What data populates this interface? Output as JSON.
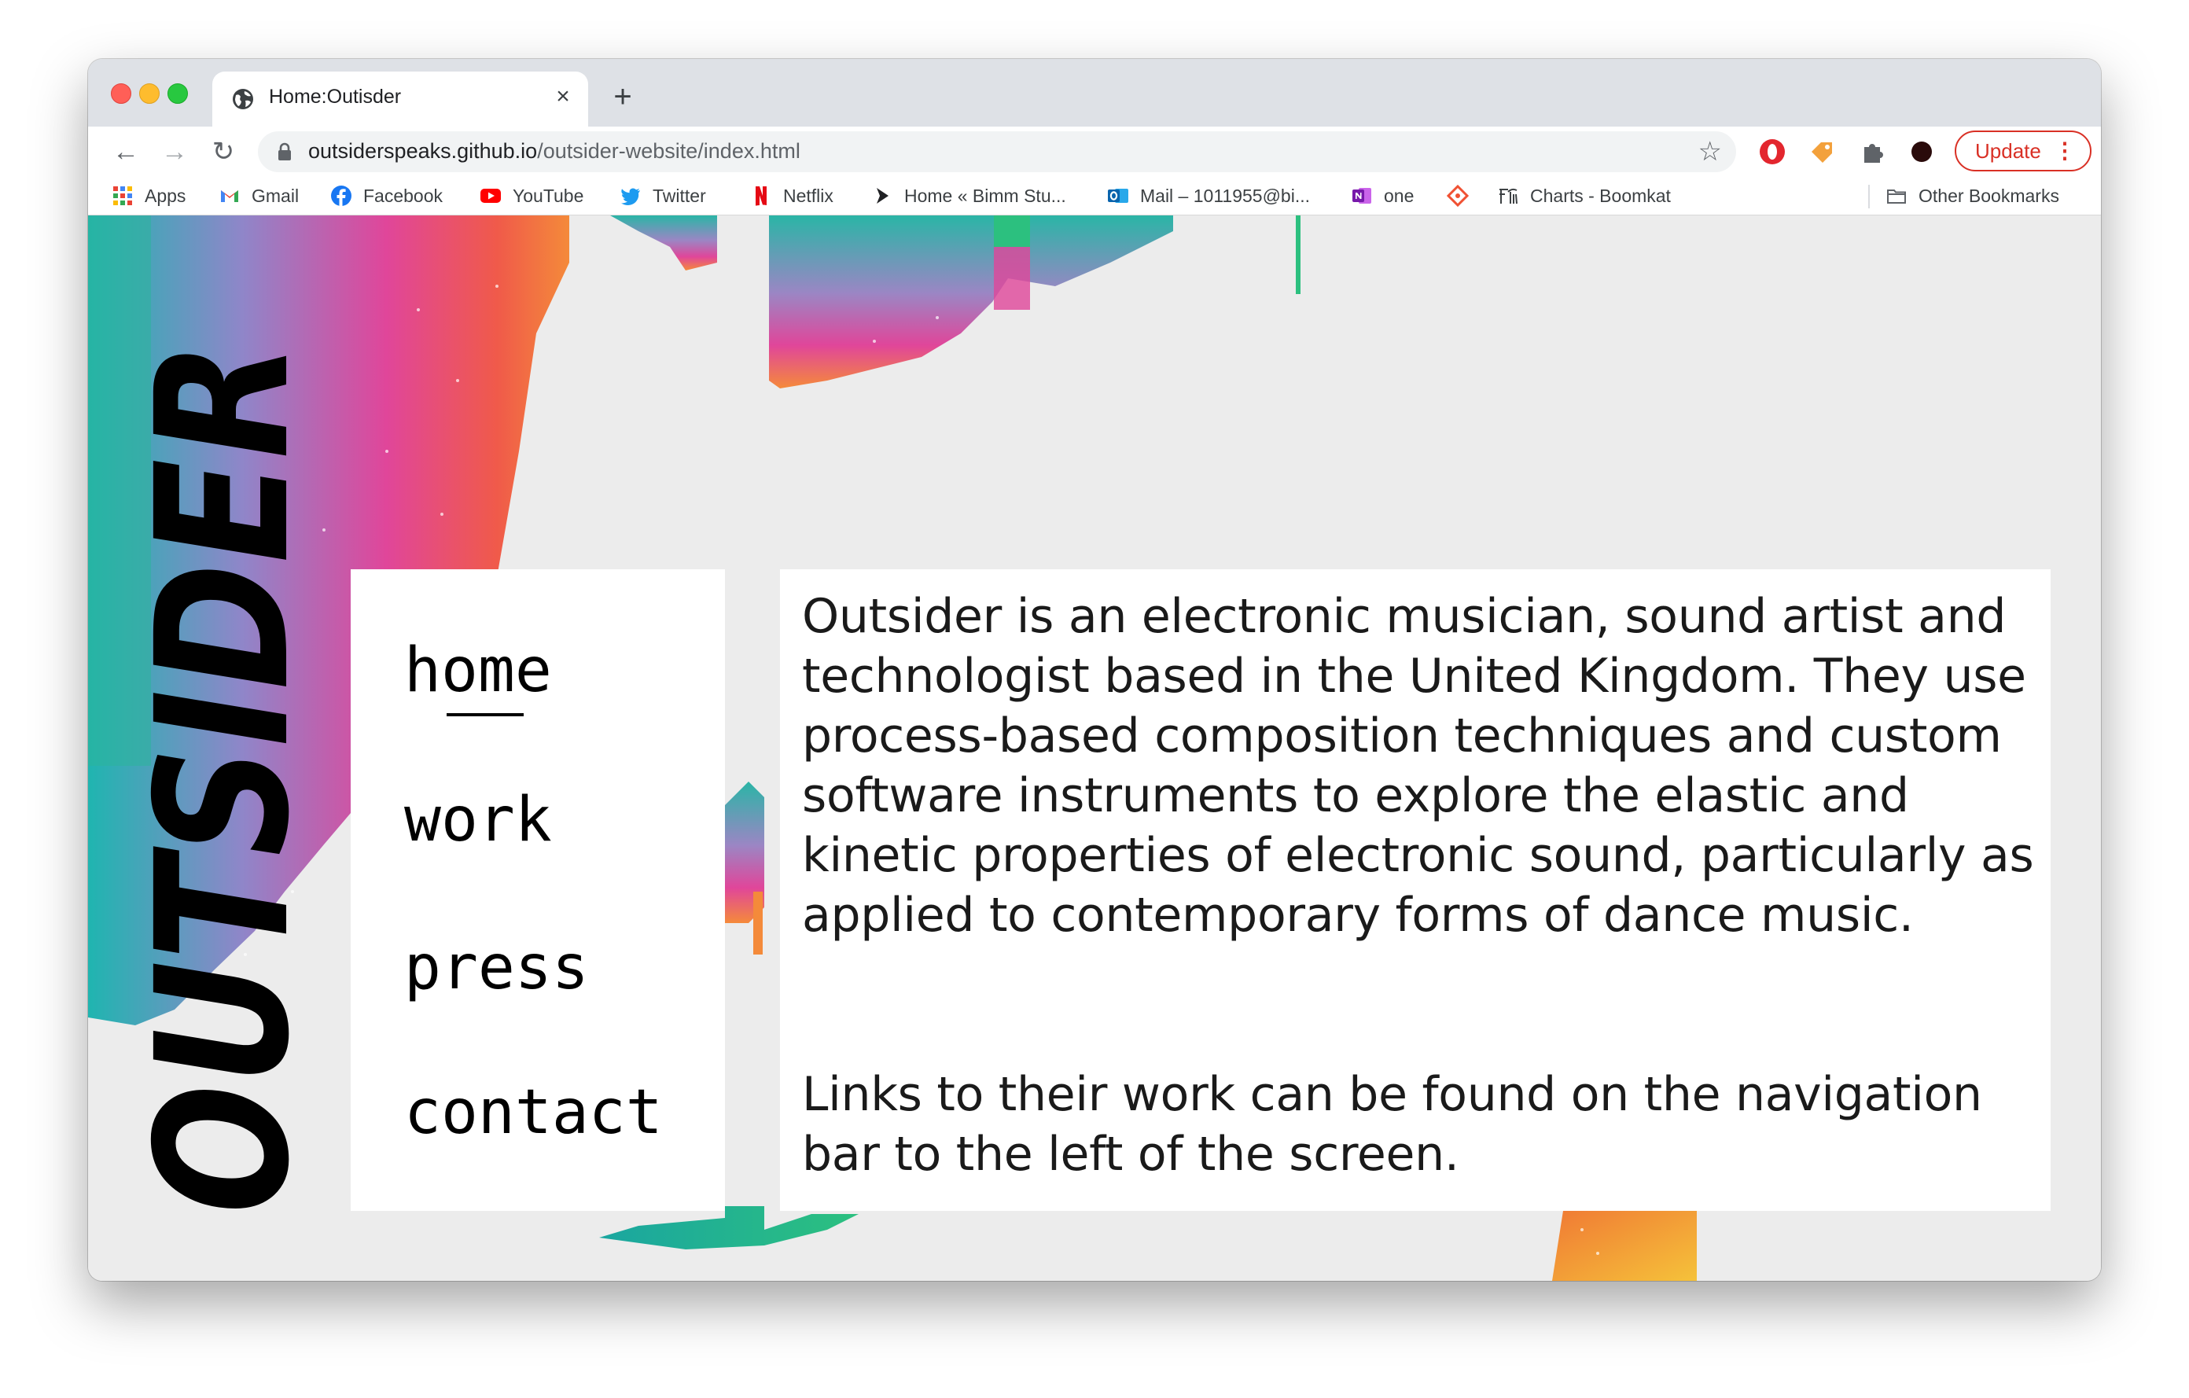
{
  "browser": {
    "tab": {
      "title": "Home:Outisder",
      "close_glyph": "×"
    },
    "new_tab_glyph": "+",
    "nav": {
      "back_glyph": "←",
      "forward_glyph": "→",
      "reload_glyph": "↻"
    },
    "url": {
      "host": "outsiderspeaks.github.io",
      "path": "/outsider-website/index.html"
    },
    "star_glyph": "☆",
    "update_label": "Update",
    "menu_glyph": "⋮",
    "bookmarks": [
      {
        "label": "Apps",
        "icon": "apps-grid-icon"
      },
      {
        "label": "Gmail",
        "icon": "gmail-icon"
      },
      {
        "label": "Facebook",
        "icon": "facebook-icon"
      },
      {
        "label": "YouTube",
        "icon": "youtube-icon"
      },
      {
        "label": "Twitter",
        "icon": "twitter-icon"
      },
      {
        "label": "Netflix",
        "icon": "netflix-icon"
      },
      {
        "label": "Home « Bimm Stu...",
        "icon": "bimm-icon"
      },
      {
        "label": "Mail – 1011955@bi...",
        "icon": "outlook-icon"
      },
      {
        "label": "one",
        "icon": "onenote-icon"
      },
      {
        "label": "",
        "icon": "git-icon"
      },
      {
        "label": "Charts - Boomkat",
        "icon": "boomkat-icon"
      }
    ],
    "other_bookmarks": "Other Bookmarks"
  },
  "site": {
    "logo": "OUTSIDER",
    "nav": {
      "home": "home",
      "work": "work",
      "press": "press",
      "contact": "contact"
    },
    "about": {
      "p1": "Outsider is an electronic musician, sound artist and technologist based in the United Kingdom. They use process-based composition techniques and custom software instruments to explore the elastic and kinetic properties of electronic sound, particularly as applied to contemporary forms of dance music.",
      "p2": "Links to their work can be found on the navigation bar to the left of the screen."
    }
  },
  "colors": {
    "accent_red": "#d93025",
    "page_bg": "#ececec",
    "gradient": [
      "#1fb5b0",
      "#8f7fc4",
      "#e0469a",
      "#f2733a",
      "#f5c23a"
    ]
  }
}
